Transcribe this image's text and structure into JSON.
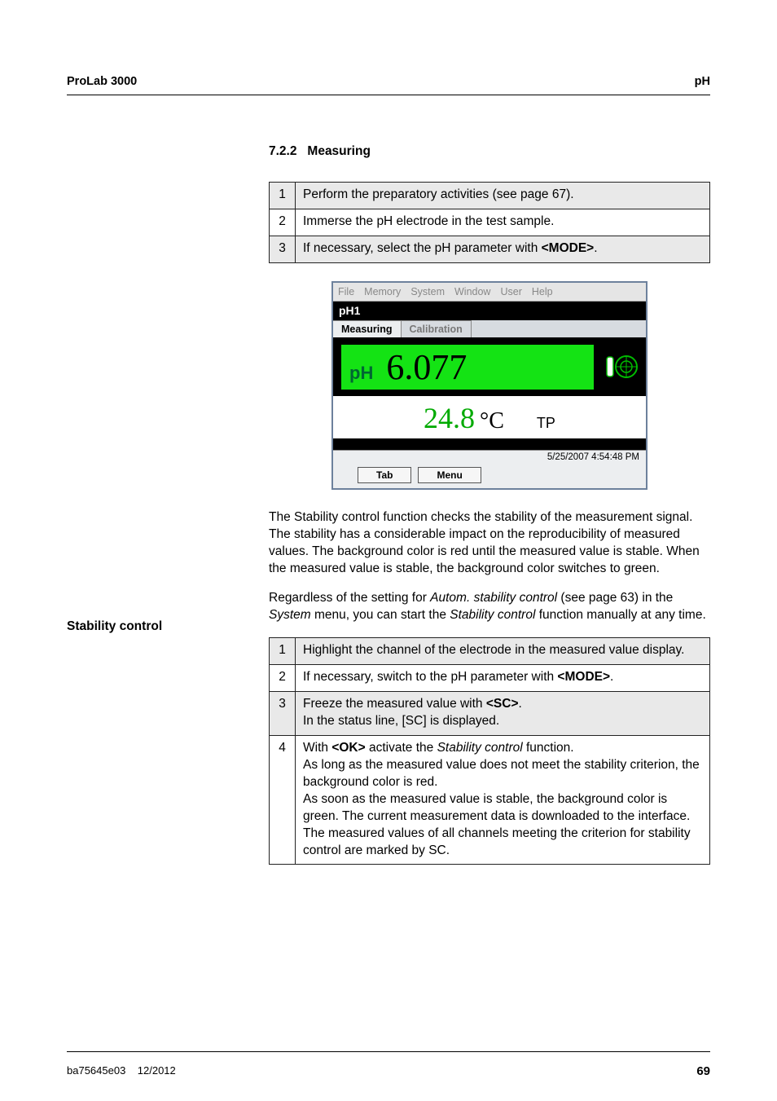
{
  "header": {
    "left": "ProLab 3000",
    "right": "pH"
  },
  "section": {
    "number": "7.2.2",
    "title": "Measuring"
  },
  "steps1": [
    {
      "n": "1",
      "t": "Perform the preparatory activities (see page 67).",
      "shade": true
    },
    {
      "n": "2",
      "t": "Immerse the pH electrode in the test sample.",
      "shade": false
    },
    {
      "n": "3",
      "t_pre": "If necessary, select the pH parameter with ",
      "key": "<MODE>",
      "t_post": ".",
      "shade": true
    }
  ],
  "device": {
    "menus": [
      "File",
      "Memory",
      "System",
      "Window",
      "User",
      "Help"
    ],
    "title": "pH1",
    "tabs": [
      "Measuring",
      "Calibration"
    ],
    "ph_label": "pH",
    "ph_value": "6.077",
    "temp_value": "24.8",
    "temp_unit": "°C",
    "tp": "TP",
    "timestamp": "5/25/2007 4:54:48 PM",
    "buttons": [
      "Tab",
      "Menu"
    ]
  },
  "stability": {
    "label": "Stability control",
    "p1": "The Stability control function checks the stability of the measurement signal. The stability has a considerable impact on the reproducibility of measured values. The background color is red until the measured value is stable. When the measured value is stable, the background color switches to green.",
    "p2_a": "Regardless of the setting for ",
    "p2_i1": "Autom. stability control",
    "p2_b": " (see page 63) in the ",
    "p2_i2": "System",
    "p2_c": " menu, you can start the ",
    "p2_i3": "Stability control",
    "p2_d": " function manually at any time."
  },
  "steps2": {
    "r1": {
      "n": "1",
      "t": "Highlight the channel of the electrode in the measured value display."
    },
    "r2": {
      "n": "2",
      "t_pre": "If necessary, switch to the pH parameter with ",
      "key": "<MODE>",
      "t_post": "."
    },
    "r3": {
      "n": "3",
      "l1_pre": "Freeze the measured value with ",
      "l1_key": "<SC>",
      "l1_post": ".",
      "l2": "In the status line, [SC] is displayed."
    },
    "r4": {
      "n": "4",
      "l1_pre": "With ",
      "l1_key": "<OK>",
      "l1_mid": " activate the ",
      "l1_i": "Stability control",
      "l1_post": " function.",
      "rest": "As long as the measured value does not meet the stability criterion, the background color is red.\nAs soon as the measured value is stable, the background color is green. The current measurement data is downloaded to the interface. The measured values of all channels meeting the criterion for stability control are marked by SC."
    }
  },
  "footer": {
    "doc": "ba75645e03",
    "date": "12/2012",
    "page": "69"
  }
}
